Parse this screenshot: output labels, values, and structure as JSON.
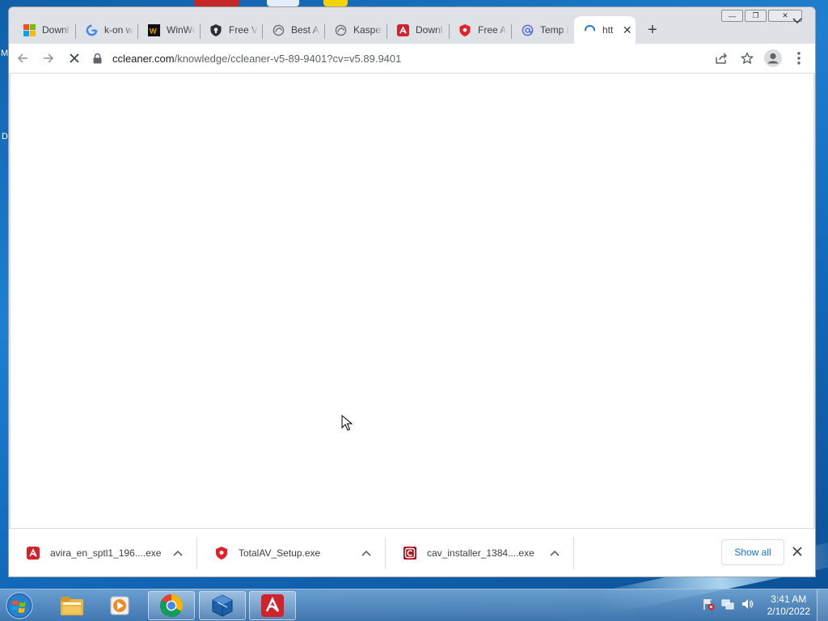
{
  "desktop": {
    "edge_m": "M",
    "edge_d": "D"
  },
  "browser": {
    "tabs": [
      {
        "title": "Downl",
        "icon": "microsoft-icon"
      },
      {
        "title": "k-on w",
        "icon": "google-icon"
      },
      {
        "title": "WinWc",
        "icon": "winworld-icon"
      },
      {
        "title": "Free V",
        "icon": "shield-icon"
      },
      {
        "title": "Best A",
        "icon": "spiral-icon"
      },
      {
        "title": "Kasper",
        "icon": "spiral-icon"
      },
      {
        "title": "Downl",
        "icon": "avira-icon"
      },
      {
        "title": "Free A",
        "icon": "totalav-shield-icon"
      },
      {
        "title": "Temp I",
        "icon": "at-icon"
      },
      {
        "title": "htt",
        "icon": "loading-spinner-icon",
        "active": true
      }
    ],
    "new_tab_label": "+",
    "address": {
      "domain": "ccleaner.com",
      "path": "/knowledge/ccleaner-v5-89-9401?cv=v5.89.9401"
    },
    "downloads": [
      {
        "name": "avira_en_sptl1_196....exe",
        "icon": "avira-icon"
      },
      {
        "name": "TotalAV_Setup.exe",
        "icon": "totalav-shield-icon"
      },
      {
        "name": "cav_installer_1384....exe",
        "icon": "comodo-icon"
      }
    ],
    "show_all_label": "Show all"
  },
  "taskbar": {
    "apps": [
      "windows-explorer-icon",
      "media-player-icon",
      "chrome-icon",
      "virtualbox-icon",
      "avira-icon"
    ],
    "time": "3:41 AM",
    "date": "2/10/2022"
  },
  "colors": {
    "avira_red": "#d0232c",
    "chrome_blue": "#1a73e8",
    "tab_strip": "#dee1e6"
  }
}
